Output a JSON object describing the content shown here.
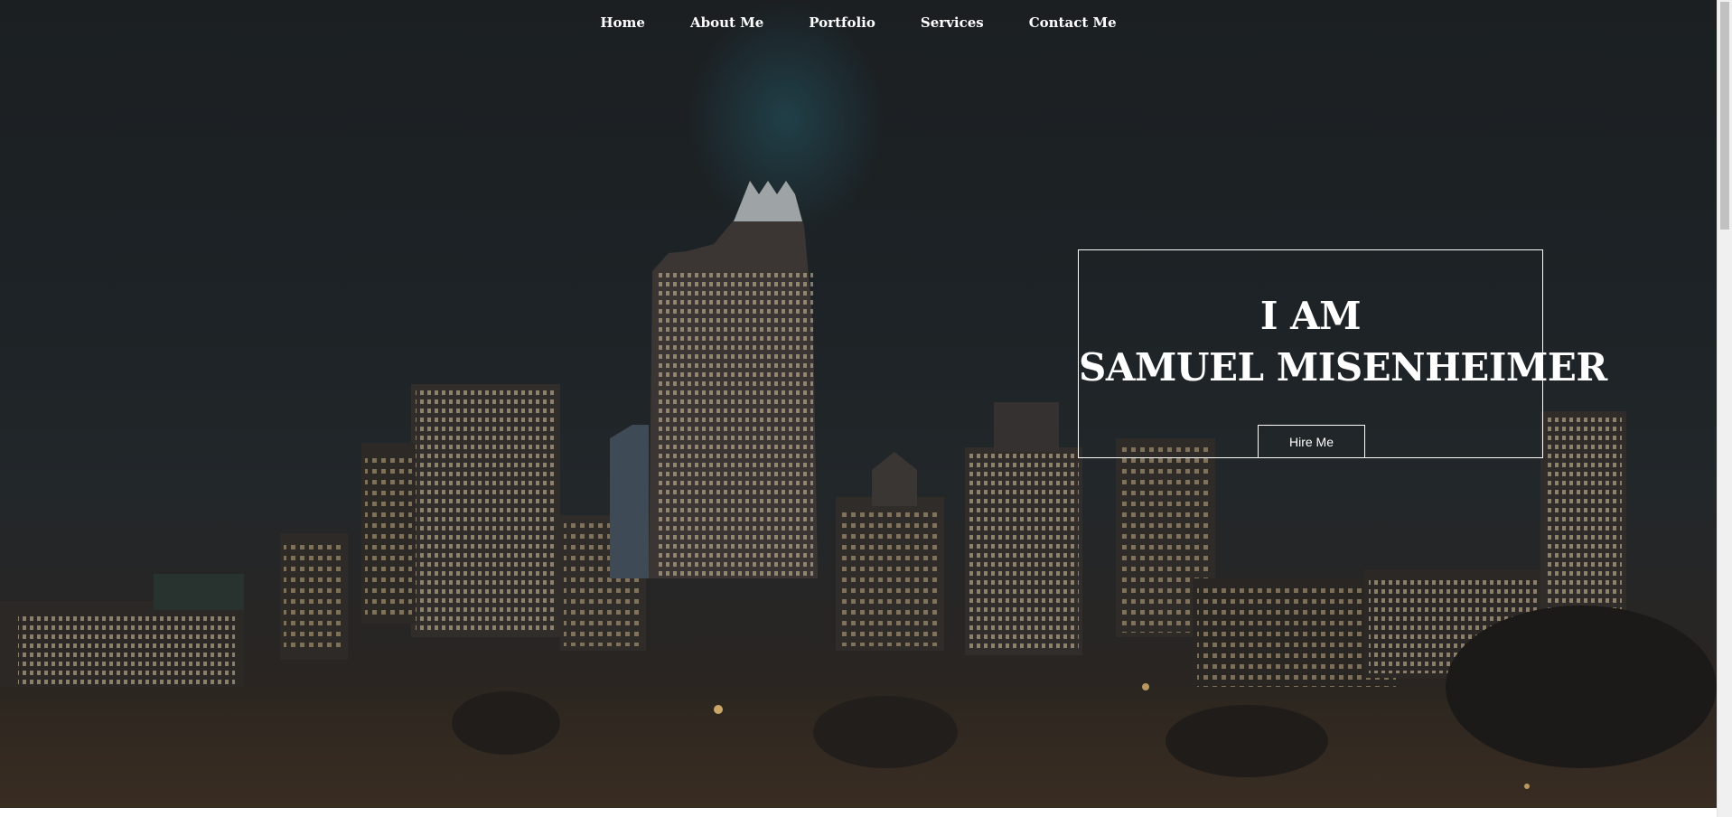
{
  "nav": {
    "items": [
      {
        "label": "Home"
      },
      {
        "label": "About Me"
      },
      {
        "label": "Portfolio"
      },
      {
        "label": "Services"
      },
      {
        "label": "Contact Me"
      }
    ]
  },
  "hero": {
    "line1": "I AM",
    "line2": "SAMUEL MISENHEIMER",
    "cta_label": "Hire Me",
    "background_image": "night city skyline",
    "overlay_color": "#1e2326"
  },
  "colors": {
    "text": "#ffffff",
    "border": "#ffffff"
  }
}
